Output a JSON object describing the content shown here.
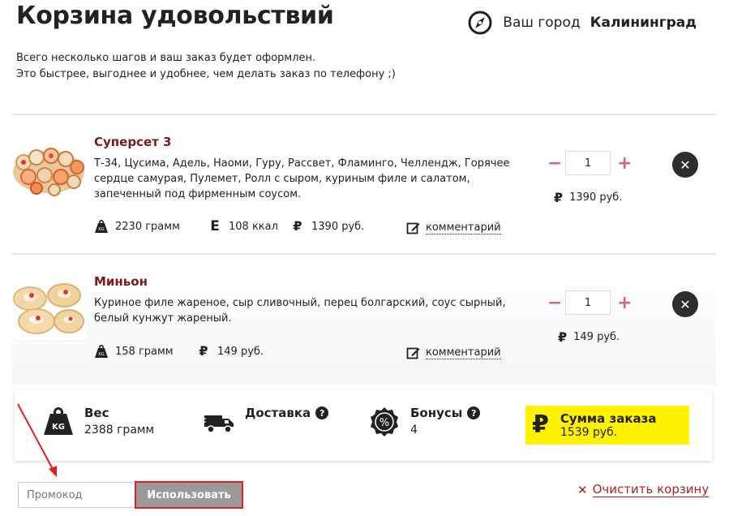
{
  "header": {
    "title": "Корзина удовольствий",
    "city_prefix": "Ваш город",
    "city_name": "Калининград"
  },
  "intro": {
    "line1": "Всего несколько шагов и ваш заказ будет оформлен.",
    "line2": "Это быстрее, выгоднее и удобнее, чем делать заказ по телефону ;)"
  },
  "items": [
    {
      "name": "Суперсет 3",
      "description": "Т-34, Цусима, Адель, Наоми, Гуру, Рассвет, Фламинго, Челлендж, Горячее сердце самурая, Пулемет, Ролл с сыром, куриным филе и салатом, запеченный под фирменным соусом.",
      "weight": "2230 грамм",
      "kcal": "108 ккал",
      "price": "1390 руб.",
      "comment_label": "комментарий",
      "qty_minus": "−",
      "quantity": "1",
      "qty_plus": "+",
      "line_total": "1390 руб."
    },
    {
      "name": "Миньон",
      "description": "Куриное филе жареное, сыр сливочный, перец болгарский, соус сырный, белый кунжут жареный.",
      "weight": "158 грамм",
      "price": "149 руб.",
      "comment_label": "комментарий",
      "qty_minus": "−",
      "quantity": "1",
      "qty_plus": "+",
      "line_total": "149 руб."
    }
  ],
  "summary": {
    "weight_title": "Вес",
    "weight_value": "2388 грамм",
    "delivery_title": "Доставка",
    "bonus_title": "Бонусы",
    "bonus_value": "4",
    "total_title": "Сумма заказа",
    "total_value": "1539 руб."
  },
  "promo": {
    "placeholder": "Промокод",
    "apply_label": "Использовать"
  },
  "clear_label": "Очистить корзину",
  "icons": {
    "ruble": "₽",
    "energy": "E",
    "question": "?",
    "remove": "✕",
    "clear": "✕"
  },
  "colors": {
    "accent_red": "#b21e1e",
    "highlight_yellow": "#fff200",
    "qty_pink": "#d9657b"
  }
}
